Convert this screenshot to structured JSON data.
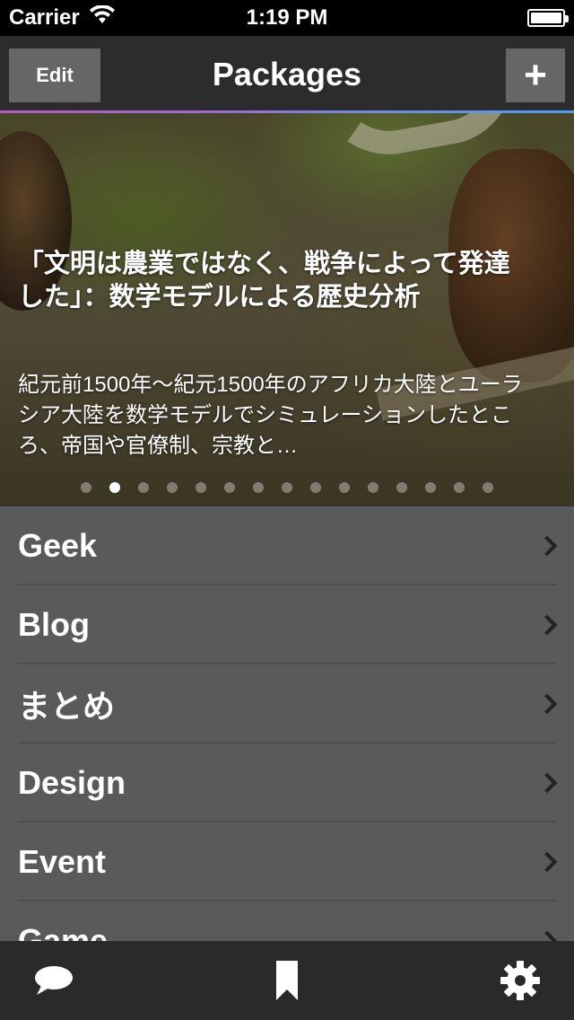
{
  "status_bar": {
    "carrier": "Carrier",
    "time": "1:19 PM",
    "wifi_icon": "wifi-icon",
    "battery_icon": "battery-icon",
    "battery_level": 1.0
  },
  "nav": {
    "title": "Packages",
    "edit_label": "Edit",
    "add_label": "+"
  },
  "hero": {
    "title": "「文明は農業ではなく、戦争によって発達した」：数学モデルによる歴史分析",
    "description": "紀元前1500年〜紀元1500年のアフリカ大陸とユーラシア大陸を数学モデルでシミュレーションしたところ、帝国や官僚制、宗教と…",
    "page_count": 15,
    "current_page": 2
  },
  "list": {
    "items": [
      {
        "label": "Geek"
      },
      {
        "label": "Blog"
      },
      {
        "label": "まとめ"
      },
      {
        "label": "Design"
      },
      {
        "label": "Event"
      },
      {
        "label": "Game"
      }
    ]
  },
  "tab_bar": {
    "icons": [
      "chat-bubble-icon",
      "bookmark-icon",
      "gear-icon"
    ]
  },
  "colors": {
    "nav_bg": "#2c2c2c",
    "list_bg": "#5a5a5a",
    "accent_start": "#b45ac8",
    "accent_end": "#4aa0f0"
  }
}
